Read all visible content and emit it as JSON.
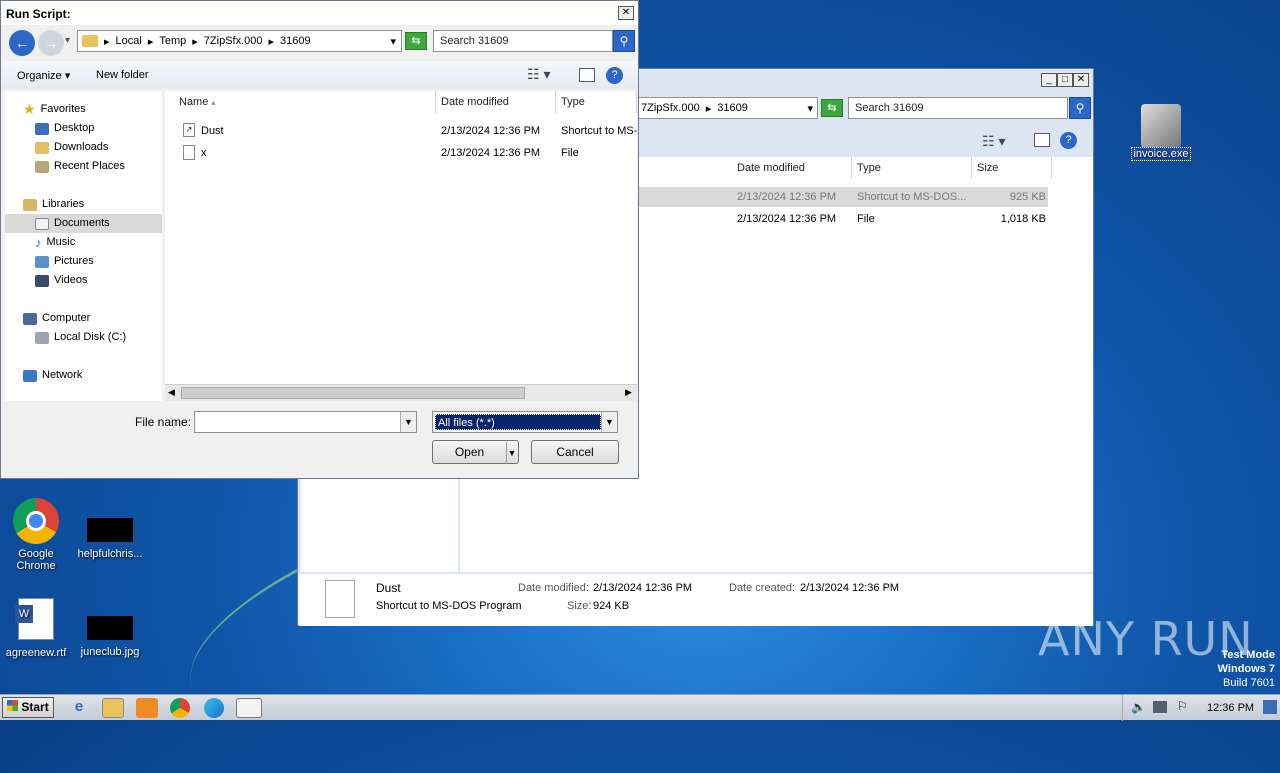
{
  "dialog": {
    "title": "Run Script:",
    "breadcrumb": [
      "Local",
      "Temp",
      "7ZipSfx.000",
      "31609"
    ],
    "search_text": "Search 31609",
    "toolbar": {
      "organize": "Organize",
      "new_folder": "New folder"
    },
    "columns": {
      "name": "Name",
      "date": "Date modified",
      "type": "Type"
    },
    "nav": {
      "favorites": "Favorites",
      "desktop": "Desktop",
      "downloads": "Downloads",
      "recent": "Recent Places",
      "libraries": "Libraries",
      "documents": "Documents",
      "music": "Music",
      "pictures": "Pictures",
      "videos": "Videos",
      "computer": "Computer",
      "local_disk": "Local Disk (C:)",
      "network": "Network"
    },
    "files": [
      {
        "name": "Dust",
        "date": "2/13/2024 12:36 PM",
        "type": "Shortcut to MS-"
      },
      {
        "name": "x",
        "date": "2/13/2024 12:36 PM",
        "type": "File"
      }
    ],
    "file_name_label": "File name:",
    "file_name_value": "",
    "filter": "All files (*.*)",
    "open": "Open",
    "cancel": "Cancel"
  },
  "explorer": {
    "breadcrumb": [
      "7ZipSfx.000",
      "31609"
    ],
    "search_text": "Search 31609",
    "columns": {
      "date": "Date modified",
      "type": "Type",
      "size": "Size"
    },
    "rows": [
      {
        "date": "2/13/2024 12:36 PM",
        "type": "Shortcut to MS-DOS...",
        "size": "925 KB"
      },
      {
        "date": "2/13/2024 12:36 PM",
        "type": "File",
        "size": "1,018 KB"
      }
    ],
    "details": {
      "name": "Dust",
      "subtitle": "Shortcut to MS-DOS Program",
      "date_modified_label": "Date modified:",
      "date_modified": "2/13/2024 12:36 PM",
      "date_created_label": "Date created:",
      "date_created": "2/13/2024 12:36 PM",
      "size_label": "Size:",
      "size": "924 KB"
    }
  },
  "desktop": {
    "icons": [
      "invoice.exe",
      "Google Chrome",
      "helpfulchris...",
      "agreenew.rtf",
      "juneclub.jpg"
    ],
    "watermark": "ANY RUN",
    "test_mode": [
      "Test Mode",
      "Windows 7",
      "Build 7601"
    ]
  },
  "taskbar": {
    "start": "Start",
    "clock": "12:36 PM"
  }
}
